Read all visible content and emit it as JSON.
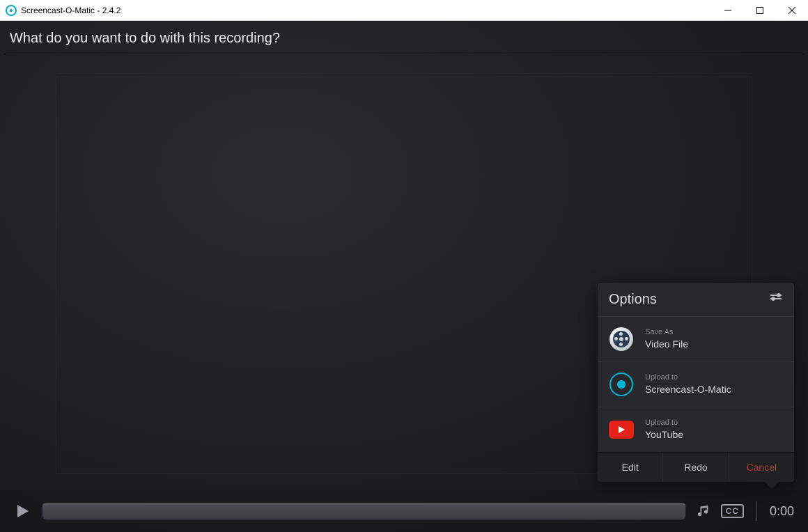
{
  "window": {
    "title": "Screencast-O-Matic - 2.4.2"
  },
  "heading": "What do you want to do with this recording?",
  "playback": {
    "time": "0:00",
    "cc_label": "CC"
  },
  "options": {
    "title": "Options",
    "items": [
      {
        "caption": "Save As",
        "label": "Video File"
      },
      {
        "caption": "Upload to",
        "label": "Screencast-O-Matic"
      },
      {
        "caption": "Upload to",
        "label": "YouTube"
      }
    ],
    "actions": {
      "edit": "Edit",
      "redo": "Redo",
      "cancel": "Cancel"
    }
  }
}
